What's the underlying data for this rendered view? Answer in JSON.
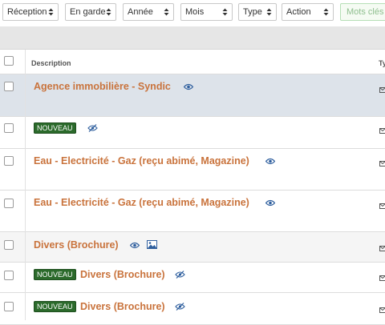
{
  "filters": [
    {
      "label": "Réception"
    },
    {
      "label": "En garde"
    },
    {
      "label": "Année"
    },
    {
      "label": "Mois"
    },
    {
      "label": "Type"
    },
    {
      "label": "Action"
    }
  ],
  "keyword_placeholder": "Mots clés",
  "table": {
    "header_description": "Description",
    "header_type": "Ty"
  },
  "rows": [
    {
      "title": "Agence immobilière - Syndic",
      "badge": "",
      "icons": [
        "eye-icon"
      ],
      "selected": true
    },
    {
      "title": "",
      "badge": "NOUVEAU",
      "icons": [
        "eye-slash-icon"
      ]
    },
    {
      "title": "Eau - Electricité - Gaz (reçu abimé, Magazine)",
      "badge": "",
      "icons": [
        "eye-icon"
      ]
    },
    {
      "title": "Eau - Electricité - Gaz (reçu abimé, Magazine)",
      "badge": "",
      "icons": [
        "eye-icon"
      ]
    },
    {
      "title": "Divers (Brochure)",
      "badge": "",
      "icons": [
        "eye-icon",
        "image-icon"
      ]
    },
    {
      "title": "Divers (Brochure)",
      "badge": "NOUVEAU",
      "icons": [
        "eye-slash-icon"
      ]
    },
    {
      "title": "Divers (Brochure)",
      "badge": "NOUVEAU",
      "icons": [
        "eye-slash-icon"
      ]
    }
  ],
  "colors": {
    "title": "#c9733c",
    "badge_bg": "#2b6a2b",
    "selected_row": "#dde3ea",
    "icon": "#2f5f9e"
  }
}
